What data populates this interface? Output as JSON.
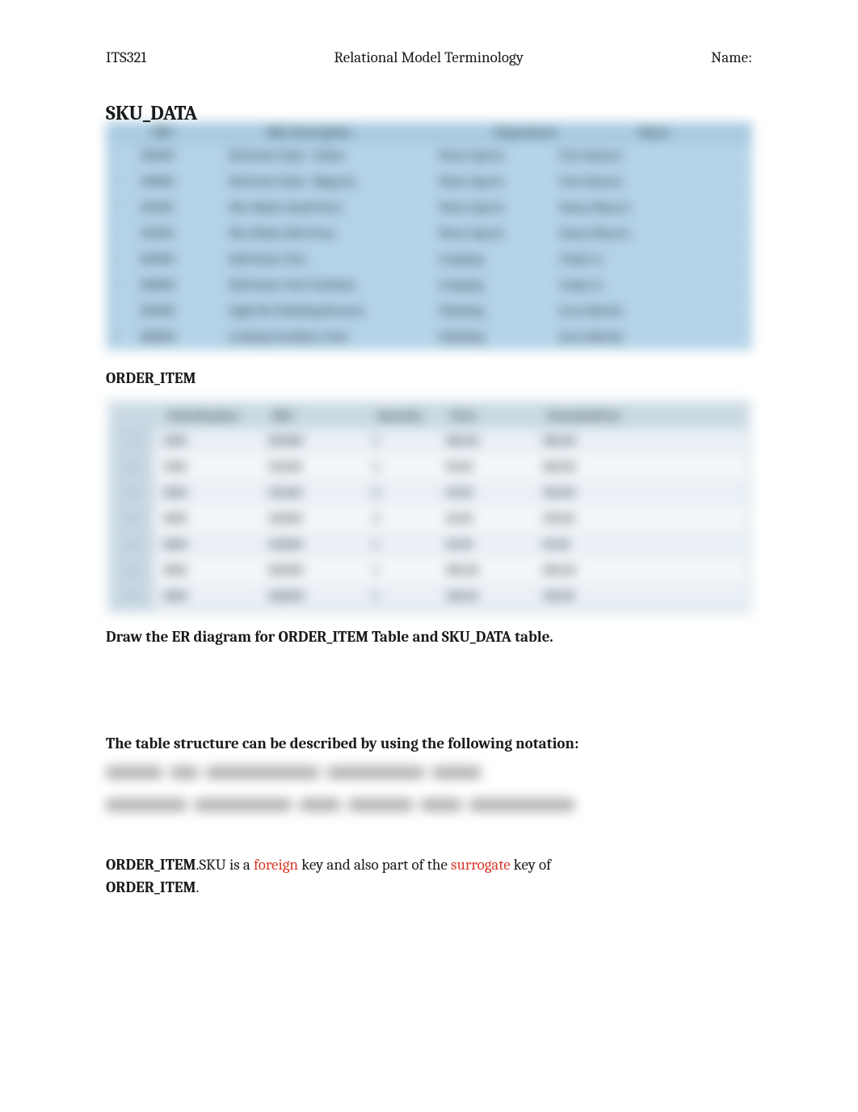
{
  "header": {
    "course": "ITS321",
    "title": "Relational Model Terminology",
    "name_label": "Name:"
  },
  "section1": {
    "heading": "SKU_DATA"
  },
  "sku_table": {
    "headers": [
      "SKU",
      "SKU_Description",
      "Department",
      "Buyer"
    ],
    "rows": [
      {
        "n": "1",
        "sku": "100100",
        "desc": "Std Scuba Tank - Yellow",
        "dept": "Water Sports",
        "buyer": "Pete Hansen"
      },
      {
        "n": "2",
        "sku": "100200",
        "desc": "Std Scuba Tank - Magenta",
        "dept": "Water Sports",
        "buyer": "Pete Hansen"
      },
      {
        "n": "3",
        "sku": "101100",
        "desc": "Dive Mask, Small Clear",
        "dept": "Water Sports",
        "buyer": "Nancy Meyers"
      },
      {
        "n": "4",
        "sku": "101200",
        "desc": "Dive Mask, Med Clear",
        "dept": "Water Sports",
        "buyer": "Nancy Meyers"
      },
      {
        "n": "5",
        "sku": "201000",
        "desc": "Half-dome Tent",
        "dept": "Camping",
        "buyer": "Cindy Lo"
      },
      {
        "n": "6",
        "sku": "202000",
        "desc": "Half-dome Tent Vestibule",
        "dept": "Camping",
        "buyer": "Cindy Lo"
      },
      {
        "n": "7",
        "sku": "301000",
        "desc": "Light Fly Climbing Harness",
        "dept": "Climbing",
        "buyer": "Jerry Martin"
      },
      {
        "n": "8",
        "sku": "302000",
        "desc": "Locking Carabiner, Oval",
        "dept": "Climbing",
        "buyer": "Jerry Martin"
      }
    ]
  },
  "section2": {
    "heading": "ORDER_ITEM"
  },
  "order_item_table": {
    "headers": [
      "OrderNumber",
      "SKU",
      "Quantity",
      "Price",
      "ExtendedPrice"
    ],
    "rows": [
      {
        "n": "1",
        "on": "1000",
        "sku": "201000",
        "qty": "1",
        "price": "300.00",
        "ext": "300.00"
      },
      {
        "n": "2",
        "on": "1000",
        "sku": "101100",
        "qty": "4",
        "price": "50.00",
        "ext": "200.00"
      },
      {
        "n": "3",
        "on": "2000",
        "sku": "101100",
        "qty": "2",
        "price": "50.00",
        "ext": "100.00"
      },
      {
        "n": "4",
        "on": "2000",
        "sku": "101200",
        "qty": "2",
        "price": "50.00",
        "ext": "100.00"
      },
      {
        "n": "5",
        "on": "3000",
        "sku": "101200",
        "qty": "1",
        "price": "50.00",
        "ext": "50.00"
      },
      {
        "n": "6",
        "on": "3000",
        "sku": "201000",
        "qty": "1",
        "price": "300.00",
        "ext": "300.00"
      },
      {
        "n": "7",
        "on": "3000",
        "sku": "202000",
        "qty": "1",
        "price": "130.00",
        "ext": "130.00"
      }
    ]
  },
  "instruction1": "Draw the ER diagram for ORDER_ITEM Table and SKU_DATA table.",
  "instruction2": "The table structure can be described by using the following notation:",
  "notation": {
    "line1": "SKU_DATA (SKU, SKU_Description, Department, Buyer)",
    "line2": "ORDER_ITEM (OrderNumber, SKU, Quantity, Price, ExtendedPrice)"
  },
  "final": {
    "part1_bold": "ORDER_ITEM",
    "part2": ".SKU is   a ",
    "part3_red": "foreign",
    "part4": "  key and also part of the ",
    "part5_red": "surrogate",
    "part6": " key of ",
    "part7_bold": "ORDER_ITEM",
    "part8": "."
  }
}
